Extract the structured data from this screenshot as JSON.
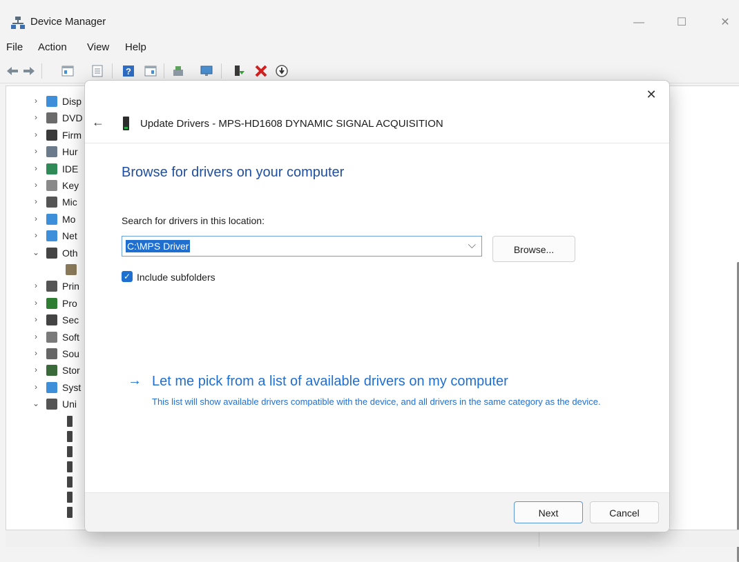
{
  "window": {
    "title": "Device Manager",
    "minimize_glyph": "—",
    "maximize_glyph": "☐",
    "close_glyph": "✕"
  },
  "menu": [
    "File",
    "Action",
    "View",
    "Help"
  ],
  "toolbar": {
    "icons": [
      "back-icon",
      "forward-icon",
      "show-hide-tree-icon",
      "properties-icon",
      "help-icon",
      "action-pane-icon",
      "scan-hardware-icon",
      "monitor-icon",
      "update-driver-icon",
      "uninstall-icon",
      "disable-device-icon"
    ]
  },
  "tree": {
    "categories": [
      {
        "label": "Disp",
        "chevron": ">",
        "icon": "display-adapter-icon"
      },
      {
        "label": "DVD",
        "chevron": ">",
        "icon": "dvd-drive-icon"
      },
      {
        "label": "Firm",
        "chevron": ">",
        "icon": "firmware-icon"
      },
      {
        "label": "Hur",
        "chevron": ">",
        "icon": "hid-icon"
      },
      {
        "label": "IDE",
        "chevron": ">",
        "icon": "ide-controller-icon"
      },
      {
        "label": "Key",
        "chevron": ">",
        "icon": "keyboard-icon"
      },
      {
        "label": "Mic",
        "chevron": ">",
        "icon": "mouse-icon"
      },
      {
        "label": "Mo",
        "chevron": ">",
        "icon": "monitor-icon"
      },
      {
        "label": "Net",
        "chevron": ">",
        "icon": "network-adapter-icon"
      },
      {
        "label": "Oth",
        "chevron": "v",
        "icon": "other-devices-icon"
      },
      {
        "label": "",
        "chevron": "",
        "icon": "unknown-device-warning-icon"
      },
      {
        "label": "Prin",
        "chevron": ">",
        "icon": "print-queue-icon"
      },
      {
        "label": "Pro",
        "chevron": ">",
        "icon": "processor-icon"
      },
      {
        "label": "Sec",
        "chevron": ">",
        "icon": "security-device-icon"
      },
      {
        "label": "Soft",
        "chevron": ">",
        "icon": "software-device-icon"
      },
      {
        "label": "Sou",
        "chevron": ">",
        "icon": "sound-icon"
      },
      {
        "label": "Stor",
        "chevron": ">",
        "icon": "storage-controller-icon"
      },
      {
        "label": "Syst",
        "chevron": ">",
        "icon": "system-devices-icon"
      },
      {
        "label": "Uni",
        "chevron": "v",
        "icon": "usb-controller-icon"
      }
    ],
    "usb_children_count": 7
  },
  "dialog": {
    "close_glyph": "✕",
    "back_glyph": "←",
    "title": "Update Drivers - MPS-HD1608 DYNAMIC SIGNAL ACQUISITION",
    "heading": "Browse for drivers on your computer",
    "search_label": "Search for drivers in this location:",
    "path_value": "C:\\MPS Driver",
    "browse_label": "Browse...",
    "include_subfolders_label": "Include subfolders",
    "include_subfolders_checked": true,
    "pick_arrow": "→",
    "pick_link": "Let me pick from a list of available drivers on my computer",
    "pick_description": "This list will show available drivers compatible with the device, and all drivers in the same category as the device.",
    "next_label": "Next",
    "cancel_label": "Cancel"
  },
  "colors": {
    "accent": "#1f6fd0",
    "heading": "#1f4fa0"
  }
}
